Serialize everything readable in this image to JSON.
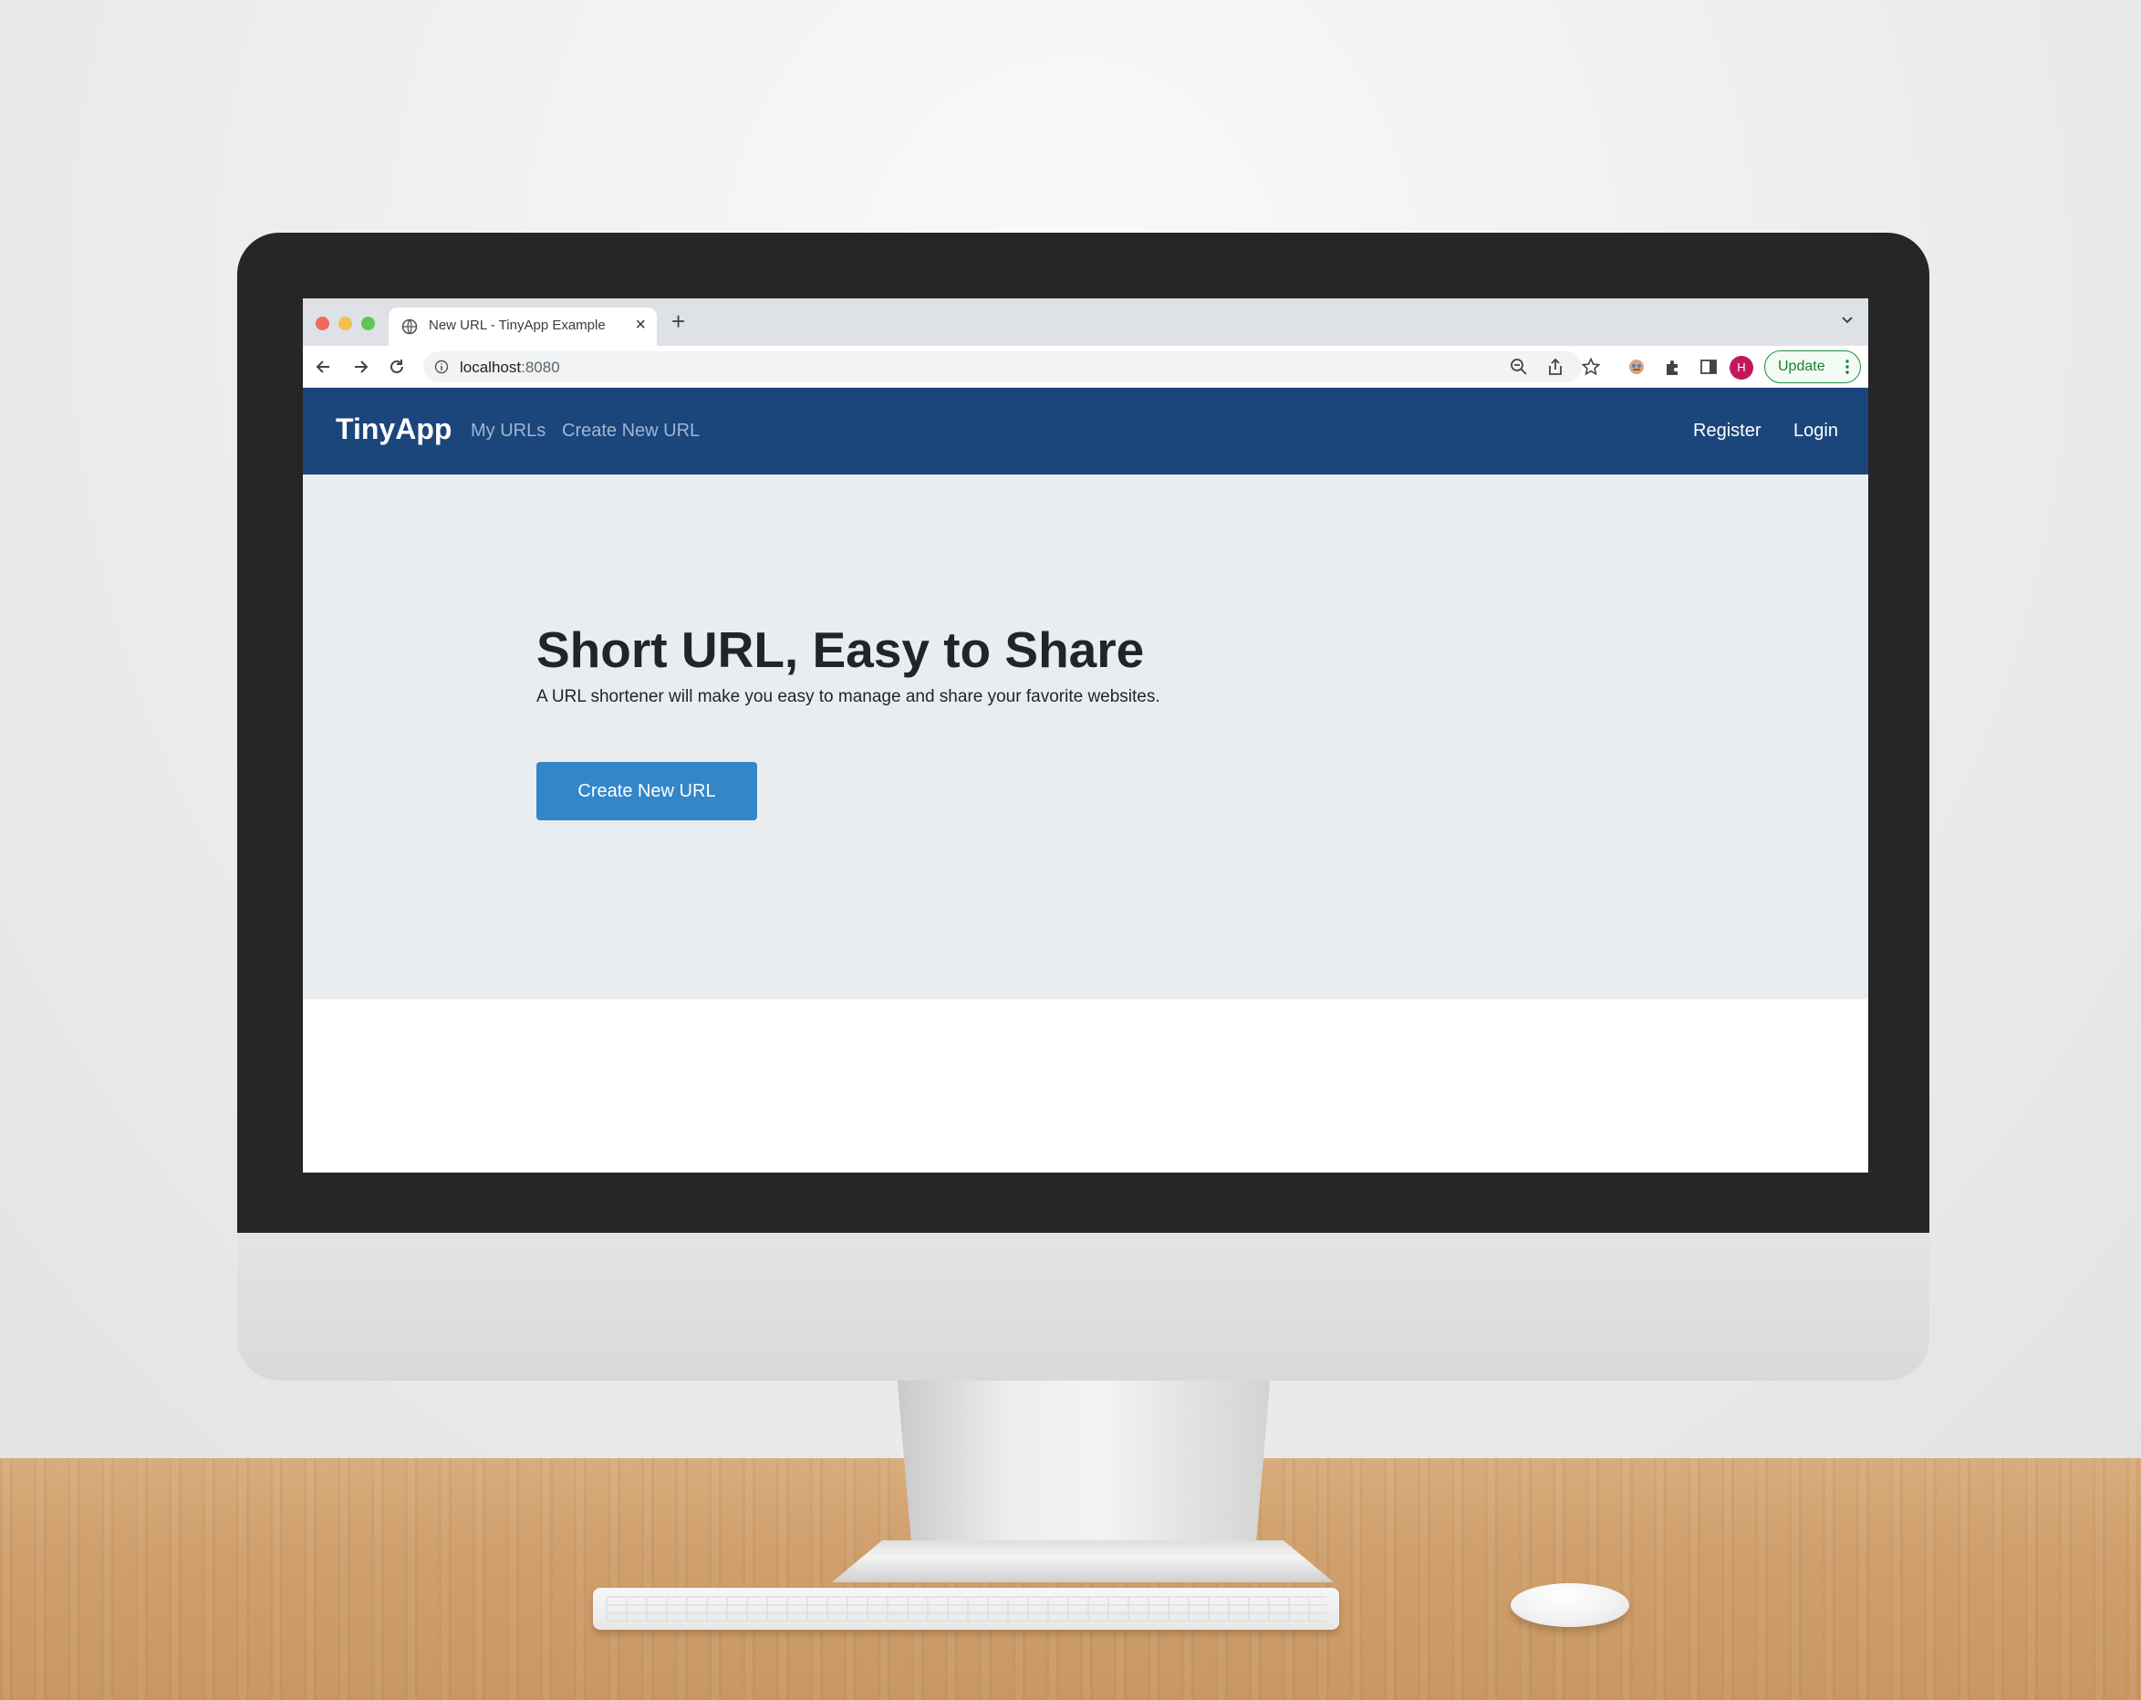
{
  "browser": {
    "tab_title": "New URL - TinyApp Example",
    "new_tab_symbol": "+",
    "close_symbol": "×",
    "address_host": "localhost",
    "address_port": ":8080",
    "profile_initial": "H",
    "update_label": "Update"
  },
  "navbar": {
    "brand": "TinyApp",
    "links": {
      "my_urls": "My URLs",
      "create_new_url": "Create New URL",
      "register": "Register",
      "login": "Login"
    }
  },
  "hero": {
    "title": "Short URL, Easy to Share",
    "lead": "A URL shortener will make you easy to manage and share your favorite websites.",
    "cta_label": "Create New URL"
  },
  "colors": {
    "navbar_bg": "#1b467c",
    "hero_bg": "#e9edf0",
    "cta_bg": "#3386c8",
    "nav_link_muted": "#9fb5d3",
    "update_accent": "#1e8e3e",
    "profile_avatar": "#c2185b"
  },
  "icons": {
    "tab_favicon": "globe-icon",
    "back": "back-arrow-icon",
    "forward": "forward-arrow-icon",
    "reload": "reload-icon",
    "site_info": "info-icon",
    "zoom": "zoom-icon",
    "share": "share-icon",
    "bookmark": "star-icon",
    "extension_avatar": "extension-icon",
    "extensions": "puzzle-icon",
    "side_panel": "side-panel-icon",
    "menu": "kebab-menu-icon",
    "tab_list": "chevron-down-icon"
  }
}
